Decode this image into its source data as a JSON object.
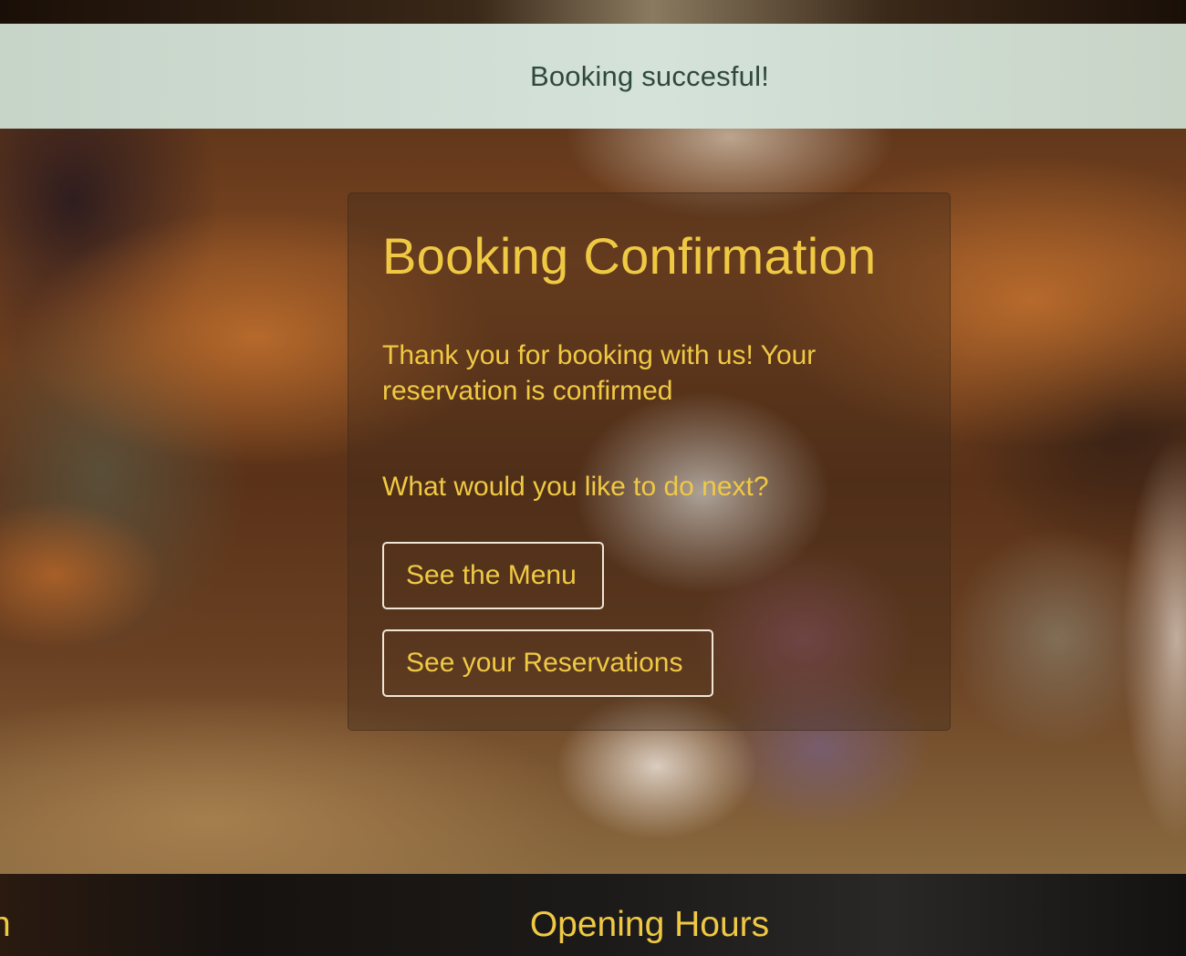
{
  "alert": {
    "message": "Booking succesful!"
  },
  "confirmation": {
    "title": "Booking Confirmation",
    "message": "Thank you for booking with us! Your reservation is confirmed",
    "question": "What would you like to do next?",
    "buttons": {
      "menu_label": "See the Menu",
      "reservations_label": "See your Reservations"
    }
  },
  "footer": {
    "left_heading_fragment": "n",
    "opening_hours_heading": "Opening Hours"
  },
  "colors": {
    "accent": "#f0c944",
    "alert_background": "#d4e2da",
    "alert_text": "#2f4a3a",
    "footer_background": "#1c1a18"
  }
}
